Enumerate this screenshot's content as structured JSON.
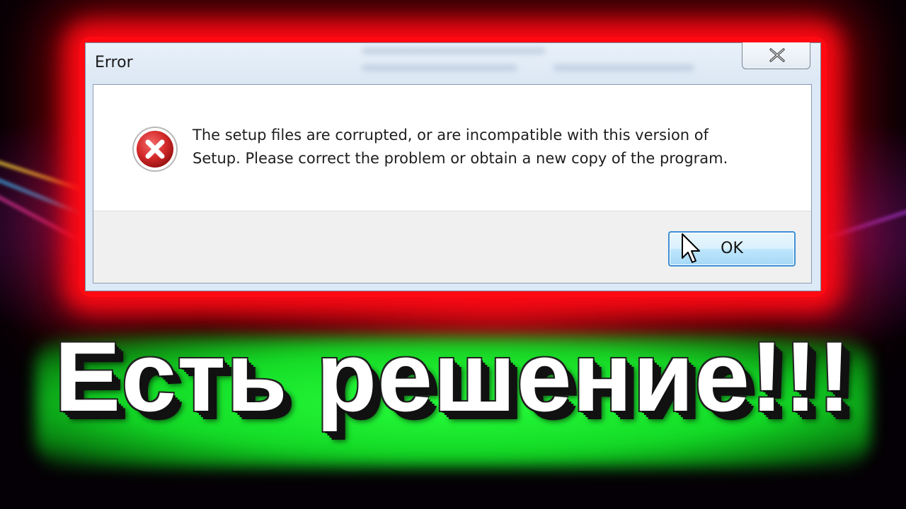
{
  "dialog": {
    "title": "Error",
    "message_line1": "The setup files are corrupted, or are incompatible with this version of",
    "message_line2": "Setup. Please correct the problem or obtain a new copy of the program.",
    "ok_label": "OK",
    "icon": "error-icon",
    "close_icon": "close-icon"
  },
  "caption": {
    "text": "Есть решение!!!"
  },
  "colors": {
    "frame_glow": "#ff0a12",
    "caption_glow": "#22ee33",
    "ok_button_border": "#3c8fd6",
    "error_icon": "#d42a2a"
  }
}
